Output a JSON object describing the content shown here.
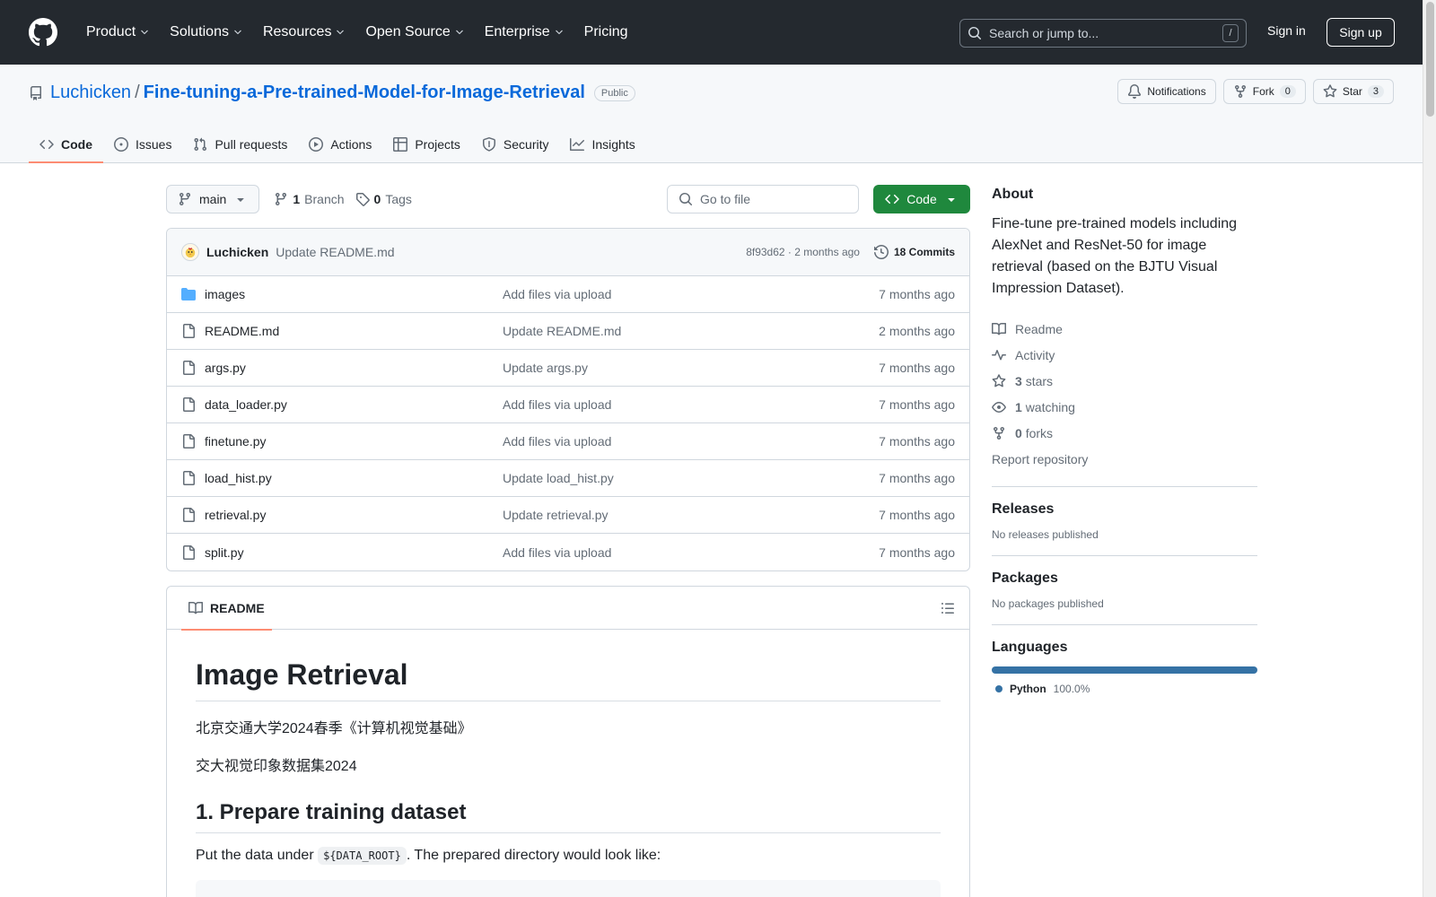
{
  "header": {
    "nav": [
      "Product",
      "Solutions",
      "Resources",
      "Open Source",
      "Enterprise",
      "Pricing"
    ],
    "search_placeholder": "Search or jump to...",
    "search_shortcut": "/",
    "sign_in": "Sign in",
    "sign_up": "Sign up"
  },
  "repo": {
    "owner": "Luchicken",
    "separator": "/",
    "name": "Fine-tuning-a-Pre-trained-Model-for-Image-Retrieval",
    "visibility": "Public",
    "notifications": "Notifications",
    "fork_label": "Fork",
    "fork_count": "0",
    "star_label": "Star",
    "star_count": "3"
  },
  "tabs": [
    "Code",
    "Issues",
    "Pull requests",
    "Actions",
    "Projects",
    "Security",
    "Insights"
  ],
  "toolbar": {
    "branch": "main",
    "branch_count": "1",
    "branch_label": "Branch",
    "tag_count": "0",
    "tag_label": "Tags",
    "goto_placeholder": "Go to file",
    "code_button": "Code"
  },
  "latest_commit": {
    "author": "Luchicken",
    "message": "Update README.md",
    "sha_time": "8f93d62 · 2 months ago",
    "commits": "18 Commits"
  },
  "files": [
    {
      "name": "images",
      "type": "folder",
      "message": "Add files via upload",
      "date": "7 months ago"
    },
    {
      "name": "README.md",
      "type": "file",
      "message": "Update README.md",
      "date": "2 months ago"
    },
    {
      "name": "args.py",
      "type": "file",
      "message": "Update args.py",
      "date": "7 months ago"
    },
    {
      "name": "data_loader.py",
      "type": "file",
      "message": "Add files via upload",
      "date": "7 months ago"
    },
    {
      "name": "finetune.py",
      "type": "file",
      "message": "Add files via upload",
      "date": "7 months ago"
    },
    {
      "name": "load_hist.py",
      "type": "file",
      "message": "Update load_hist.py",
      "date": "7 months ago"
    },
    {
      "name": "retrieval.py",
      "type": "file",
      "message": "Update retrieval.py",
      "date": "7 months ago"
    },
    {
      "name": "split.py",
      "type": "file",
      "message": "Add files via upload",
      "date": "7 months ago"
    }
  ],
  "readme": {
    "tab": "README",
    "title": "Image Retrieval",
    "line1": "北京交通大学2024春季《计算机视觉基础》",
    "line2": "交大视觉印象数据集2024",
    "h2": "1. Prepare training dataset",
    "p_before": "Put the data under ",
    "p_code": "${DATA_ROOT}",
    "p_after": ". The prepared directory would look like:"
  },
  "about": {
    "heading": "About",
    "description": "Fine-tune pre-trained models including AlexNet and ResNet-50 for image retrieval (based on the BJTU Visual Impression Dataset).",
    "readme": "Readme",
    "activity": "Activity",
    "stars_count": "3",
    "stars_label": "stars",
    "watching_count": "1",
    "watching_label": "watching",
    "forks_count": "0",
    "forks_label": "forks",
    "report": "Report repository"
  },
  "releases": {
    "heading": "Releases",
    "text": "No releases published"
  },
  "packages": {
    "heading": "Packages",
    "text": "No packages published"
  },
  "languages": {
    "heading": "Languages",
    "items": [
      {
        "name": "Python",
        "percent": "100.0%",
        "color": "#3572A5",
        "fraction": 1.0
      }
    ]
  },
  "colors": {
    "header_bg": "#24292f",
    "link": "#0969da",
    "primary_button": "#1f883d",
    "tab_underline": "#fd8c73"
  }
}
